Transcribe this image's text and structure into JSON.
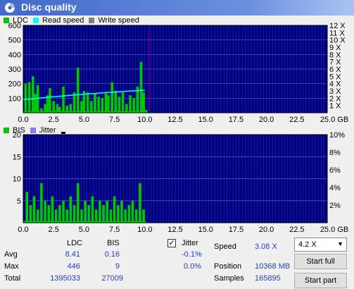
{
  "window": {
    "title": "Disc quality"
  },
  "legend_top": {
    "ldc": "LDC",
    "read": "Read speed",
    "write": "Write speed"
  },
  "legend_bottom": {
    "bis": "BIS",
    "jitter": "Jitter"
  },
  "colors": {
    "plot_bg": "#000080",
    "ldc": "#00c800",
    "read": "#00ffff",
    "write": "#ffffff",
    "bis": "#00c800",
    "jitter": "#8080ff",
    "marker": "#800080"
  },
  "chart_data": [
    {
      "type": "bar",
      "title": "",
      "x_ticks": [
        "0.0",
        "2.5",
        "5.0",
        "7.5",
        "10.0",
        "12.5",
        "15.0",
        "17.5",
        "20.0",
        "22.5",
        "25.0 GB"
      ],
      "y_ticks_left": [
        "100",
        "200",
        "300",
        "400",
        "500",
        "600"
      ],
      "y_ticks_right": [
        "1 X",
        "2 X",
        "3 X",
        "4 X",
        "5 X",
        "6 X",
        "7 X",
        "8 X",
        "9 X",
        "10 X",
        "11 X",
        "12 X"
      ],
      "xlim": [
        0,
        25
      ],
      "ylim": [
        0,
        600
      ],
      "marker_x": 10.368,
      "series": [
        {
          "name": "LDC",
          "x": [
            0.2,
            0.5,
            0.8,
            1.0,
            1.2,
            1.5,
            1.8,
            2.0,
            2.2,
            2.5,
            2.8,
            3.0,
            3.3,
            3.6,
            3.9,
            4.2,
            4.5,
            4.8,
            5.0,
            5.3,
            5.6,
            5.9,
            6.2,
            6.5,
            6.8,
            7.0,
            7.3,
            7.6,
            7.9,
            8.2,
            8.5,
            8.8,
            9.1,
            9.4,
            9.7,
            9.9,
            10.1
          ],
          "values": [
            200,
            210,
            250,
            130,
            190,
            30,
            60,
            120,
            170,
            80,
            60,
            40,
            180,
            50,
            60,
            140,
            310,
            80,
            150,
            140,
            80,
            130,
            110,
            100,
            140,
            120,
            210,
            150,
            110,
            140,
            60,
            120,
            100,
            180,
            350,
            140,
            20
          ]
        },
        {
          "name": "Read speed",
          "x": [
            0,
            2.5,
            5,
            7.5,
            10.0
          ],
          "values": [
            1.8,
            2.2,
            2.55,
            2.85,
            3.1
          ]
        }
      ]
    },
    {
      "type": "bar",
      "title": "",
      "x_ticks": [
        "0.0",
        "2.5",
        "5.0",
        "7.5",
        "10.0",
        "12.5",
        "15.0",
        "17.5",
        "20.0",
        "22.5",
        "25.0 GB"
      ],
      "y_ticks_left": [
        "5",
        "10",
        "15",
        "20"
      ],
      "y_ticks_right": [
        "2%",
        "4%",
        "6%",
        "8%",
        "10%"
      ],
      "xlim": [
        0,
        25
      ],
      "ylim": [
        0,
        20
      ],
      "series": [
        {
          "name": "BIS",
          "x": [
            0.3,
            0.6,
            0.9,
            1.2,
            1.5,
            1.8,
            2.1,
            2.4,
            2.7,
            3.0,
            3.3,
            3.6,
            3.9,
            4.2,
            4.5,
            4.8,
            5.1,
            5.4,
            5.7,
            6.0,
            6.3,
            6.6,
            6.9,
            7.2,
            7.5,
            7.8,
            8.1,
            8.4,
            8.7,
            9.0,
            9.3,
            9.6,
            9.9
          ],
          "values": [
            7,
            4,
            6,
            3,
            9,
            5,
            4,
            6,
            3,
            4,
            5,
            3,
            6,
            4,
            9,
            3,
            5,
            4,
            6,
            3,
            5,
            4,
            5,
            3,
            6,
            4,
            5,
            3,
            4,
            5,
            3,
            9,
            3
          ]
        }
      ]
    }
  ],
  "stats": {
    "col_ldc": "LDC",
    "col_bis": "BIS",
    "rows": [
      {
        "label": "Avg",
        "ldc": "8.41",
        "bis": "0.16",
        "jitter": "-0.1%"
      },
      {
        "label": "Max",
        "ldc": "446",
        "bis": "9",
        "jitter": "0.0%"
      },
      {
        "label": "Total",
        "ldc": "1395033",
        "bis": "27009"
      }
    ],
    "jitter_label": "Jitter",
    "jitter_checked": "✓"
  },
  "info": {
    "speed_label": "Speed",
    "speed_value": "3.08 X",
    "position_label": "Position",
    "position_value": "10368 MB",
    "samples_label": "Samples",
    "samples_value": "165895"
  },
  "controls": {
    "speed_select": "4.2 X",
    "start_full": "Start full",
    "start_part": "Start part"
  }
}
